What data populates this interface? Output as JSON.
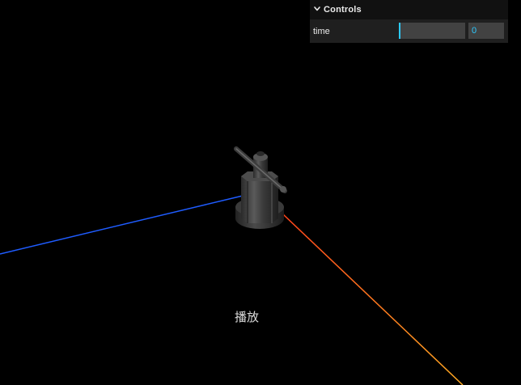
{
  "gui": {
    "title": "Controls",
    "controls": [
      {
        "label": "time",
        "value": "0",
        "progress": 0.03
      }
    ]
  },
  "play_button": {
    "label": "播放"
  },
  "colors": {
    "background": "#000000",
    "axis_x": "#ff8c1a",
    "axis_y": "#99ff66",
    "axis_z": "#1f5cff",
    "gui_background": "#1f1f1f",
    "gui_title_background": "#111111",
    "gui_accent": "#2cc9ff",
    "gui_widget": "#424242"
  },
  "icons": {
    "collapse": "chevron-down-icon"
  }
}
